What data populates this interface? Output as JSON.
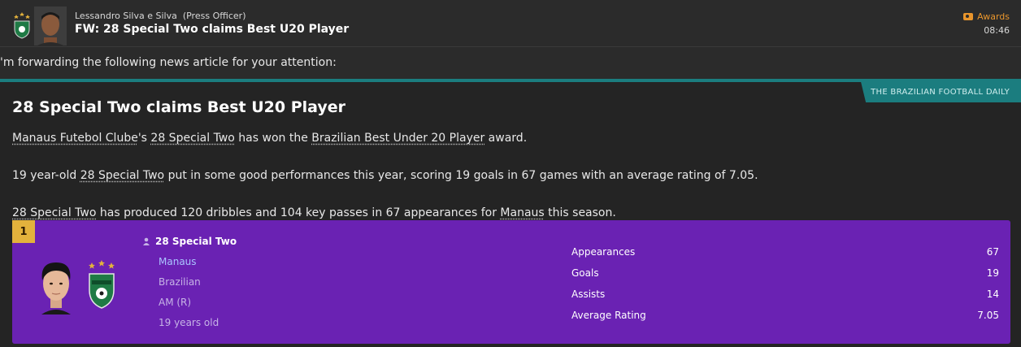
{
  "header": {
    "sender": "Lessandro Silva e Silva",
    "sender_role": "(Press Officer)",
    "subject": "FW: 28 Special Two claims Best U20 Player",
    "tag_icon": "ticket-icon",
    "tag": "Awards",
    "time": "08:46"
  },
  "intro": "'m forwarding the following news article for your attention:",
  "article": {
    "source": "THE BRAZILIAN FOOTBALL DAILY",
    "headline": "28 Special Two claims Best U20 Player",
    "p1": {
      "club": "Manaus Futebol Clube",
      "t1": "'s ",
      "player": "28 Special Two",
      "t2": " has won the ",
      "award": "Brazilian Best Under 20 Player",
      "t3": " award."
    },
    "p2": {
      "t1": "19 year-old ",
      "player": "28 Special Two",
      "t2": " put in some good performances this year, scoring 19 goals in 67 games with an average rating of 7.05."
    },
    "p3": {
      "player": "28 Special Two",
      "t1": " has produced 120 dribbles and 104 key passes in 67 appearances for ",
      "club": "Manaus",
      "t2": " this season."
    }
  },
  "card": {
    "rank": "1",
    "name": "28 Special Two",
    "club": "Manaus",
    "nationality": "Brazilian",
    "position": "AM (R)",
    "age": "19 years old",
    "stats": [
      {
        "label": "Appearances",
        "value": "67"
      },
      {
        "label": "Goals",
        "value": "19"
      },
      {
        "label": "Assists",
        "value": "14"
      },
      {
        "label": "Average Rating",
        "value": "7.05"
      }
    ]
  },
  "colors": {
    "accent_teal": "#1b7d7f",
    "card_purple": "#6a22b3",
    "tag_orange": "#e8952c",
    "rank_gold": "#e3b23c"
  }
}
